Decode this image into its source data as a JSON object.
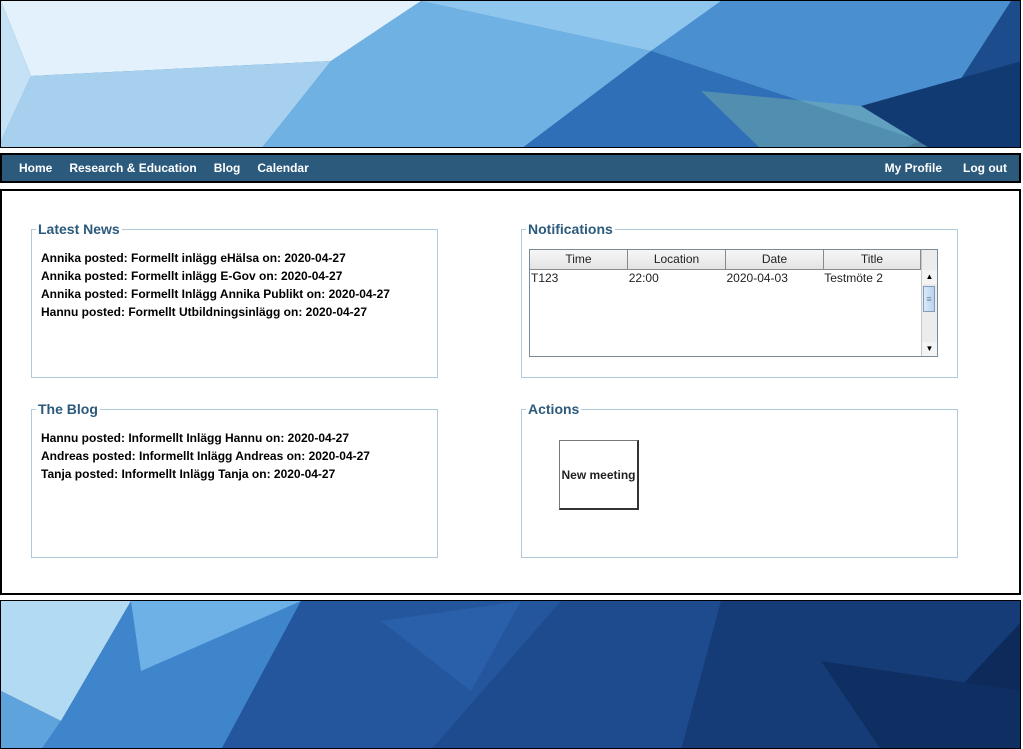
{
  "nav": {
    "left": [
      "Home",
      "Research & Education",
      "Blog",
      "Calendar"
    ],
    "right": [
      "My Profile",
      "Log out"
    ]
  },
  "news": {
    "title": "Latest News",
    "items": [
      "Annika posted: Formellt inlägg eHälsa on: 2020-04-27",
      "Annika posted: Formellt inlägg E-Gov on: 2020-04-27",
      "Annika posted: Formellt Inlägg Annika Publikt on: 2020-04-27",
      "Hannu posted: Formellt Utbildningsinlägg on: 2020-04-27"
    ]
  },
  "notifications": {
    "title": "Notifications",
    "columns": [
      "Time",
      "Location",
      "Date",
      "Title"
    ],
    "rows": [
      [
        "T123",
        "22:00",
        "2020-04-03",
        "Testmöte 2"
      ]
    ]
  },
  "blog": {
    "title": "The Blog",
    "items": [
      "Hannu posted: Informellt Inlägg Hannu on: 2020-04-27",
      "Andreas posted: Informellt Inlägg Andreas on: 2020-04-27",
      "Tanja posted: Informellt Inlägg Tanja on: 2020-04-27"
    ]
  },
  "actions": {
    "title": "Actions",
    "new_meeting_label": "New meeting"
  },
  "icons": {
    "scroll_up": "triangle-up-icon",
    "scroll_down": "triangle-down-icon",
    "scroll_grip": "grip-lines-icon"
  },
  "colors": {
    "nav_bg": "#2c5a7c",
    "heading": "#2c5a7c",
    "panel_border": "#aecbdb",
    "banner_light": "#d6ecf8",
    "banner_dark": "#0f2f63"
  }
}
